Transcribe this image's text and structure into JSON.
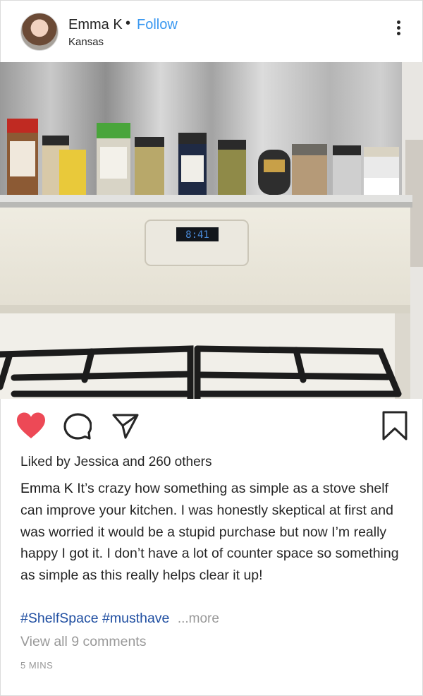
{
  "post": {
    "username": "Emma K",
    "separator": "•",
    "follow_label": "Follow",
    "location": "Kansas",
    "menu_icon": "more-vertical-icon",
    "photo": {
      "description_icon": "photo",
      "clock_display": "8:41"
    },
    "actions": {
      "like_icon": "heart-filled-icon",
      "comment_icon": "comment-icon",
      "share_icon": "share-icon",
      "save_icon": "bookmark-icon",
      "like_color": "#ed4956"
    },
    "likes": {
      "prefix": "Liked by",
      "first_liker": "Jessica",
      "middle": "and",
      "others": "260 others"
    },
    "caption": {
      "author": "Emma K",
      "text": "It’s crazy how something as simple as a stove shelf can improve your kitchen. I was honestly skeptical at first and was worried it would be a stupid purchase but now I’m really happy I got it. I don’t have a lot of counter space so something as simple as this really helps clear it up!"
    },
    "hashtags": [
      "#ShelfSpace",
      "#musthave"
    ],
    "more_label": "...more",
    "view_comments": "View all 9 comments",
    "timestamp": "5 MINS"
  }
}
